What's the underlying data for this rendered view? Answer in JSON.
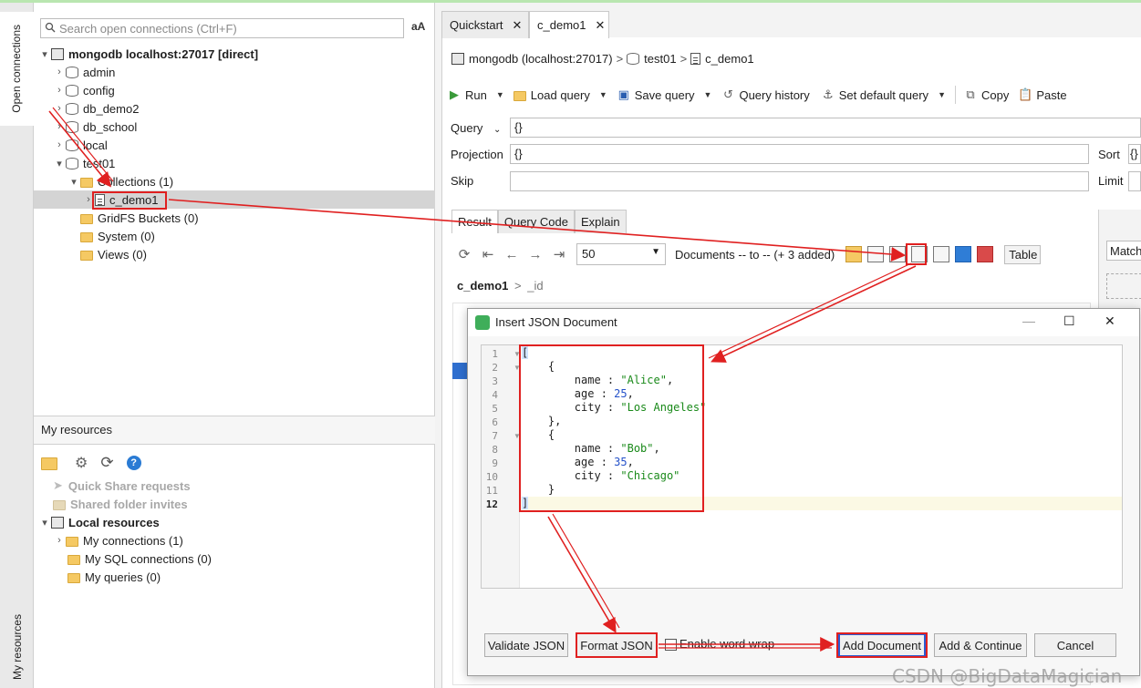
{
  "sidebar_tabs": {
    "open_connections": "Open connections",
    "my_resources": "My resources"
  },
  "search": {
    "placeholder": "Search open connections (Ctrl+F)",
    "case_toggle": "aA"
  },
  "tree": {
    "root": "mongodb localhost:27017 [direct]",
    "databases": [
      "admin",
      "config",
      "db_demo2",
      "db_school",
      "local",
      "test01"
    ],
    "collections_folder": "Collections (1)",
    "collection": "c_demo1",
    "gridfs": "GridFS Buckets (0)",
    "system": "System (0)",
    "views": "Views (0)"
  },
  "my_resources": {
    "header": "My resources",
    "quick_share": "Quick Share requests",
    "shared_folder": "Shared folder invites",
    "local_resources": "Local resources",
    "my_connections": "My connections (1)",
    "my_sql": "My SQL connections (0)",
    "my_queries": "My queries (0)"
  },
  "tabs": {
    "quickstart": "Quickstart",
    "collection": "c_demo1",
    "close": "✕"
  },
  "breadcrumb": {
    "connection": "mongodb (localhost:27017)",
    "database": "test01",
    "collection": "c_demo1",
    "separator": ">"
  },
  "toolbar": {
    "run": "Run",
    "load_query": "Load query",
    "save_query": "Save query",
    "query_history": "Query history",
    "set_default_query": "Set default query",
    "copy": "Copy",
    "paste": "Paste"
  },
  "query_form": {
    "query_label": "Query",
    "query_value": "{}",
    "projection_label": "Projection",
    "projection_value": "{}",
    "skip_label": "Skip",
    "sort_label": "Sort",
    "sort_value": "{}",
    "limit_label": "Limit"
  },
  "result_tabs": {
    "result": "Result",
    "query_code": "Query Code",
    "explain": "Explain"
  },
  "pager": {
    "page_size": "50",
    "status": "Documents -- to -- (+ 3 added)",
    "view_mode": "Table",
    "match": "Match"
  },
  "path": {
    "collection": "c_demo1",
    "field": "_id",
    "separator": ">"
  },
  "dialog": {
    "title": "Insert JSON Document",
    "minimize": "—",
    "maximize": "☐",
    "close": "✕",
    "line_numbers": [
      "1",
      "2",
      "3",
      "4",
      "5",
      "6",
      "7",
      "8",
      "9",
      "10",
      "11",
      "12"
    ],
    "lines": {
      "l1": "[",
      "l2": "    {",
      "l3_key": "        name : ",
      "l3_val": "\"Alice\"",
      "l3_end": ",",
      "l4_key": "        age : ",
      "l4_val": "25",
      "l4_end": ",",
      "l5_key": "        city : ",
      "l5_val": "\"Los Angeles\"",
      "l6": "    },",
      "l7": "    {",
      "l8_key": "        name : ",
      "l8_val": "\"Bob\"",
      "l8_end": ",",
      "l9_key": "        age : ",
      "l9_val": "35",
      "l9_end": ",",
      "l10_key": "        city : ",
      "l10_val": "\"Chicago\"",
      "l11": "    }",
      "l12": "]"
    },
    "buttons": {
      "validate": "Validate JSON",
      "format": "Format JSON",
      "word_wrap": "Enable word wrap",
      "add": "Add Document",
      "add_continue": "Add & Continue",
      "cancel": "Cancel"
    }
  },
  "watermark": "CSDN @BigDataMagician",
  "colors": {
    "annotation_red": "#e02020",
    "primary_border": "#2b5ad1",
    "string_green": "#1a8a1a",
    "number_blue": "#2451c9"
  }
}
